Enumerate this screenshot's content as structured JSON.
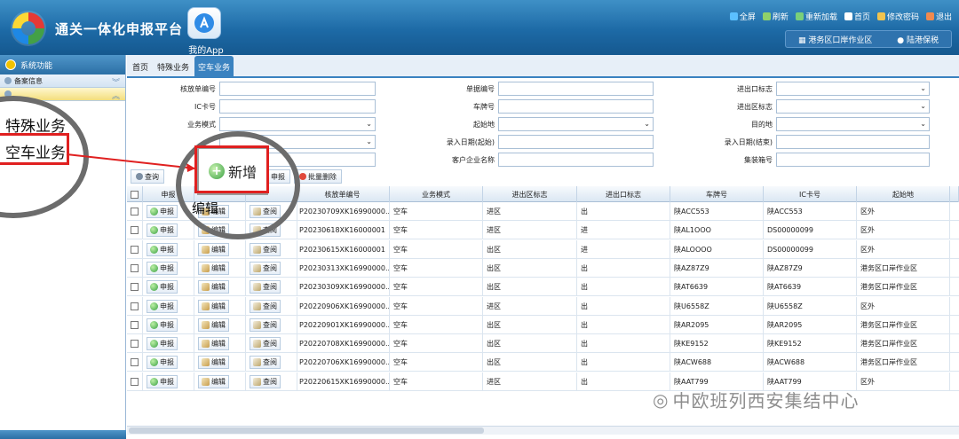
{
  "header": {
    "app_title": "通关一体化申报平台",
    "app_tile_label": "我的App",
    "top_links": [
      {
        "label": "全屏",
        "icon": "fullscreen-icon",
        "color": "#5bc0ff"
      },
      {
        "label": "刷新",
        "icon": "refresh-icon",
        "color": "#8fd16a"
      },
      {
        "label": "重新加载",
        "icon": "reload-icon",
        "color": "#7ad07a"
      },
      {
        "label": "首页",
        "icon": "home-icon",
        "color": "#ffffff"
      },
      {
        "label": "修改密码",
        "icon": "password-icon",
        "color": "#f0c44f"
      },
      {
        "label": "退出",
        "icon": "logout-icon",
        "color": "#f08a4f"
      }
    ],
    "user_bar": {
      "org": "港务区口岸作业区",
      "user": "陆港保税"
    }
  },
  "sidebar": {
    "title": "系统功能",
    "groups": [
      {
        "label": "备案信息",
        "active": false
      },
      {
        "label": "",
        "active": true
      }
    ],
    "zoom_items": [
      "特殊业务",
      "空车业务"
    ]
  },
  "tabs": [
    {
      "label": "首页",
      "active": false
    },
    {
      "label": "特殊业务",
      "active": false
    },
    {
      "label": "空车业务",
      "active": true
    }
  ],
  "form": {
    "rows": [
      [
        {
          "label": "核放单编号",
          "value": "",
          "dropdown": false
        },
        {
          "label": "单据编号",
          "value": "",
          "dropdown": false
        },
        {
          "label": "进出口标志",
          "value": "",
          "dropdown": true
        }
      ],
      [
        {
          "label": "IC卡号",
          "value": "",
          "dropdown": false
        },
        {
          "label": "车牌号",
          "value": "",
          "dropdown": false
        },
        {
          "label": "进出区标志",
          "value": "",
          "dropdown": true
        }
      ],
      [
        {
          "label": "业务模式",
          "value": "",
          "dropdown": true
        },
        {
          "label": "起始地",
          "value": "",
          "dropdown": true
        },
        {
          "label": "目的地",
          "value": "",
          "dropdown": true
        }
      ],
      [
        {
          "label": "",
          "value": "",
          "dropdown": true
        },
        {
          "label": "录入日期(起始)",
          "value": "",
          "dropdown": false
        },
        {
          "label": "录入日期(结束)",
          "value": "",
          "dropdown": false
        }
      ],
      [
        {
          "label": "",
          "value": "",
          "dropdown": false
        },
        {
          "label": "客户企业名称",
          "value": "",
          "dropdown": false
        },
        {
          "label": "集装箱号",
          "value": "",
          "dropdown": false
        }
      ]
    ]
  },
  "toolbar": {
    "query": "查询",
    "declare": "申报",
    "batch_delete": "批量删除",
    "add_zoom": "新增",
    "edit_zoom": "编辑"
  },
  "grid": {
    "columns": [
      "",
      "申报",
      "",
      "",
      "核放单编号",
      "业务模式",
      "进出区标志",
      "进出口标志",
      "车牌号",
      "IC卡号",
      "起始地",
      ""
    ],
    "action_labels": {
      "declare": "申报",
      "edit": "编辑",
      "view": "查阅"
    },
    "rows": [
      [
        "P20230709XK16990000...",
        "空车",
        "进区",
        "出",
        "陕ACC553",
        "陕ACC553",
        "区外"
      ],
      [
        "P20230618XK16000001",
        "空车",
        "进区",
        "进",
        "陕AL1OOO",
        "DS00000099",
        "区外"
      ],
      [
        "P20230615XK16000001",
        "空车",
        "出区",
        "进",
        "陕ALOOOO",
        "DS00000099",
        "区外"
      ],
      [
        "P20230313XK16990000...",
        "空车",
        "出区",
        "出",
        "陕AZ87Z9",
        "陕AZ87Z9",
        "港务区口岸作业区"
      ],
      [
        "P20230309XK16990000...",
        "空车",
        "出区",
        "出",
        "陕AT6639",
        "陕AT6639",
        "港务区口岸作业区"
      ],
      [
        "P20220906XK16990000...",
        "空车",
        "进区",
        "出",
        "陕U6558Z",
        "陕U6558Z",
        "区外"
      ],
      [
        "P20220901XK16990000...",
        "空车",
        "出区",
        "出",
        "陕AR2095",
        "陕AR2095",
        "港务区口岸作业区"
      ],
      [
        "P20220708XK16990000...",
        "空车",
        "出区",
        "出",
        "陕KE9152",
        "陕KE9152",
        "港务区口岸作业区"
      ],
      [
        "P20220706XK16990000...",
        "空车",
        "出区",
        "出",
        "陕ACW688",
        "陕ACW688",
        "港务区口岸作业区"
      ],
      [
        "P20220615XK16990000...",
        "空车",
        "进区",
        "出",
        "陕AAT799",
        "陕AAT799",
        "区外"
      ]
    ]
  },
  "watermark": "中欧班列西安集结中心",
  "colors": {
    "accent": "#3a82c0",
    "header": "#1d6aa6",
    "highlight": "#e02020"
  }
}
